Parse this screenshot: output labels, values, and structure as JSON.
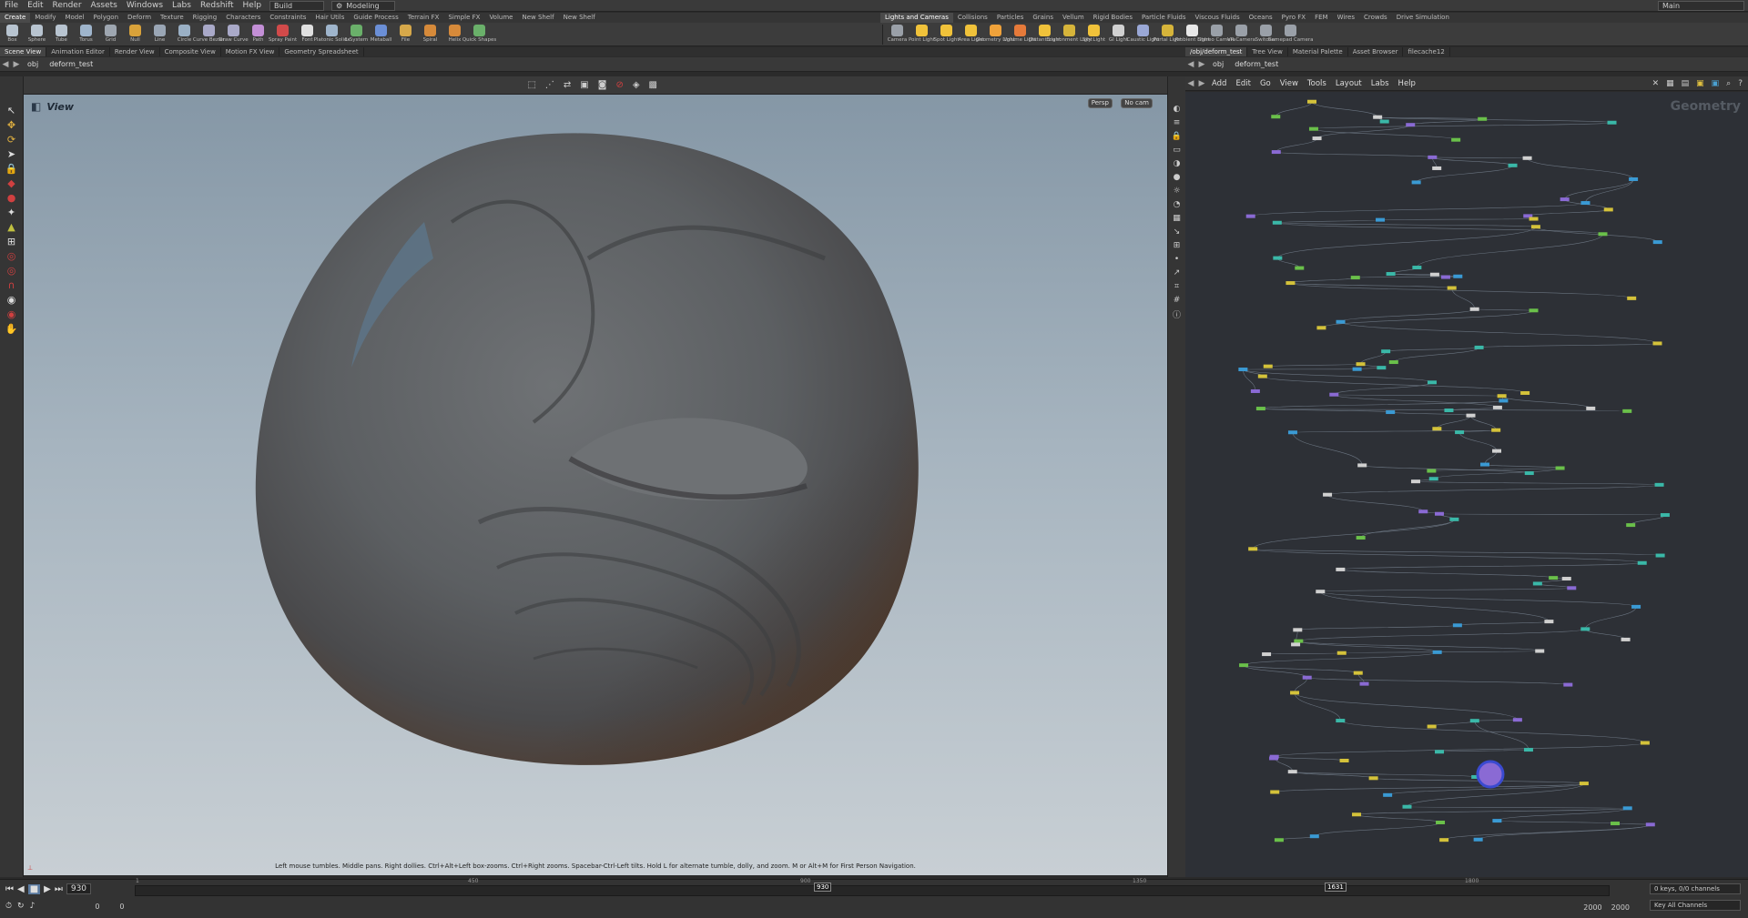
{
  "menubar": {
    "items": [
      "File",
      "Edit",
      "Render",
      "Assets",
      "Windows",
      "Labs",
      "Redshift",
      "Help"
    ],
    "desk_dropdown": "Build",
    "mode_dropdown": "Modeling",
    "desktop_dropdown": "Main"
  },
  "shelf_tabs_left": [
    "Create",
    "Modify",
    "Model",
    "Polygon",
    "Deform",
    "Texture",
    "Rigging",
    "Characters",
    "Constraints",
    "Hair Utils",
    "Guide Process",
    "Terrain FX",
    "Simple FX",
    "Volume",
    "New Shelf",
    "New Shelf"
  ],
  "shelf_tabs_right": [
    "Lights and Cameras",
    "Collisions",
    "Particles",
    "Grains",
    "Vellum",
    "Rigid Bodies",
    "Particle Fluids",
    "Viscous Fluids",
    "Oceans",
    "Pyro FX",
    "FEM",
    "Wires",
    "Crowds",
    "Drive Simulation"
  ],
  "shelf_tools_left": [
    {
      "label": "Box",
      "icon": "box-icon",
      "color": "#b8c4d0"
    },
    {
      "label": "Sphere",
      "icon": "sphere-icon",
      "color": "#b8c4d0"
    },
    {
      "label": "Tube",
      "icon": "tube-icon",
      "color": "#b8c4d0"
    },
    {
      "label": "Torus",
      "icon": "torus-icon",
      "color": "#9fb5cc"
    },
    {
      "label": "Grid",
      "icon": "grid-icon",
      "color": "#9ea6b0"
    },
    {
      "label": "Null",
      "icon": "null-icon",
      "color": "#d9a23a"
    },
    {
      "label": "Line",
      "icon": "line-icon",
      "color": "#9aa6b5"
    },
    {
      "label": "Circle",
      "icon": "circle-icon",
      "color": "#9ab0c5"
    },
    {
      "label": "Curve Bezier",
      "icon": "curve-bezier-icon",
      "color": "#a9a9c8"
    },
    {
      "label": "Draw Curve",
      "icon": "draw-curve-icon",
      "color": "#a9a9c8"
    },
    {
      "label": "Path",
      "icon": "path-icon",
      "color": "#c38fd6"
    },
    {
      "label": "Spray Paint",
      "icon": "spray-paint-icon",
      "color": "#d14a4a"
    },
    {
      "label": "Font",
      "icon": "font-icon",
      "color": "#e0e0e0"
    },
    {
      "label": "Platonic Solids",
      "icon": "platonic-solids-icon",
      "color": "#9fb5cc"
    },
    {
      "label": "L-System",
      "icon": "l-system-icon",
      "color": "#6ab06a"
    },
    {
      "label": "Metaball",
      "icon": "metaball-icon",
      "color": "#6b8fd6"
    },
    {
      "label": "File",
      "icon": "file-icon",
      "color": "#d6a84a"
    },
    {
      "label": "Spiral",
      "icon": "spiral-icon",
      "color": "#d68a3a"
    },
    {
      "label": "Helix",
      "icon": "helix-icon",
      "color": "#d68a3a"
    },
    {
      "label": "Quick Shapes",
      "icon": "quick-shapes-icon",
      "color": "#6ab06a"
    }
  ],
  "shelf_tools_right": [
    {
      "label": "Camera",
      "icon": "camera-icon",
      "color": "#9aa0a8"
    },
    {
      "label": "Point Light",
      "icon": "point-light-icon",
      "color": "#f0c23a"
    },
    {
      "label": "Spot Light",
      "icon": "spot-light-icon",
      "color": "#f0c23a"
    },
    {
      "label": "Area Light",
      "icon": "area-light-icon",
      "color": "#f0c23a"
    },
    {
      "label": "Geometry Light",
      "icon": "geometry-light-icon",
      "color": "#f0a23a"
    },
    {
      "label": "Volume Light",
      "icon": "volume-light-icon",
      "color": "#e67a3a"
    },
    {
      "label": "Distant Light",
      "icon": "distant-light-icon",
      "color": "#f0c23a"
    },
    {
      "label": "Environment Light",
      "icon": "environment-light-icon",
      "color": "#d6b43a"
    },
    {
      "label": "Sky Light",
      "icon": "sky-light-icon",
      "color": "#f0c23a"
    },
    {
      "label": "GI Light",
      "icon": "gi-light-icon",
      "color": "#d0d0d0"
    },
    {
      "label": "Caustic Light",
      "icon": "caustic-light-icon",
      "color": "#9aa8d6"
    },
    {
      "label": "Portal Light",
      "icon": "portal-light-icon",
      "color": "#d6b43a"
    },
    {
      "label": "Ambient Light",
      "icon": "ambient-light-icon",
      "color": "#e8e8e8"
    },
    {
      "label": "Stereo Camera",
      "icon": "stereo-camera-icon",
      "color": "#9aa0a8"
    },
    {
      "label": "VR Camera",
      "icon": "vr-camera-icon",
      "color": "#9aa0a8"
    },
    {
      "label": "Switcher",
      "icon": "switcher-icon",
      "color": "#9aa0a8"
    },
    {
      "label": "Gamepad Camera",
      "icon": "gamepad-camera-icon",
      "color": "#9aa0a8"
    }
  ],
  "pane_tabs_left": [
    "Scene View",
    "Animation Editor",
    "Render View",
    "Composite View",
    "Motion FX View",
    "Geometry Spreadsheet"
  ],
  "pane_tabs_right": [
    "/obj/deform_test",
    "Tree View",
    "Material Palette",
    "Asset Browser",
    "filecache12"
  ],
  "left_path": {
    "obj": "obj",
    "node": "deform_test"
  },
  "right_path": {
    "obj": "obj",
    "node": "deform_test"
  },
  "viewport": {
    "title": "View",
    "camera_badge": "Persp",
    "cam_badge": "No cam",
    "hint": "Left mouse tumbles. Middle pans. Right dollies. Ctrl+Alt+Left box-zooms. Ctrl+Right zooms. Spacebar-Ctrl-Left tilts. Hold L for alternate tumble, dolly, and zoom. M or Alt+M for First Person Navigation."
  },
  "network": {
    "menu": [
      "Add",
      "Edit",
      "Go",
      "View",
      "Tools",
      "Layout",
      "Labs",
      "Help"
    ],
    "context_label": "Geometry"
  },
  "timeline": {
    "current_frame": "930",
    "marker_frame": "1631",
    "ticks": [
      "1",
      "450",
      "900",
      "1350",
      "1800"
    ],
    "start": "1",
    "start_field": "0",
    "end_a": "2000",
    "end_b": "2000",
    "keys_label": "0 keys, 0/0 channels",
    "key_all": "Key All Channels"
  }
}
